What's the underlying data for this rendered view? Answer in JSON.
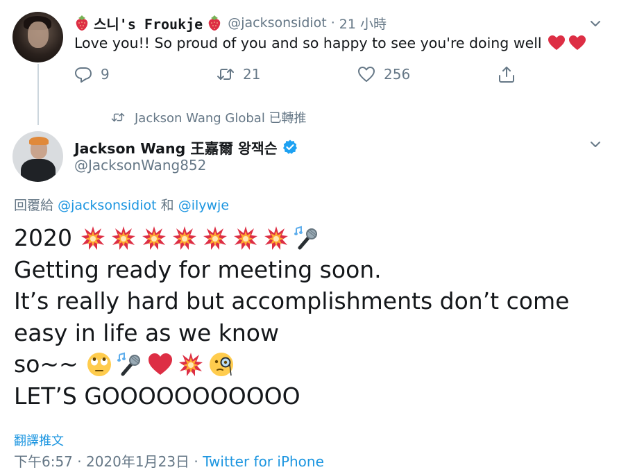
{
  "tweet1": {
    "display_name": "스니's Froukje",
    "handle": "@jacksonsidiot",
    "separator": "·",
    "time": "21 小時",
    "text": "Love you!! So proud of you and so happy to see you're doing well",
    "actions": {
      "replies": "9",
      "retweets": "21",
      "likes": "256"
    }
  },
  "retweet_banner": {
    "text": "Jackson Wang Global 已轉推"
  },
  "tweet2": {
    "display_name": "Jackson Wang 王嘉爾 왕잭슨",
    "handle": "@JacksonWang852",
    "verified": true,
    "reply_prefix": "回覆給",
    "reply_user_1": "@jacksonsidiot",
    "reply_conjunction": "和",
    "reply_user_2": "@ilywje",
    "lines": {
      "l1": "2020",
      "l2": "Getting ready for meeting soon.",
      "l3": "It’s really hard but accomplishments don’t come",
      "l4": "easy in life as we know",
      "l5": "so~~",
      "l6": "LET’S GOOOOOOOOOOO"
    },
    "translate_label": "翻譯推文",
    "timestamp": "下午6:57 · 2020年1月23日",
    "footer_separator": "·",
    "source": "Twitter for iPhone"
  },
  "icons": {
    "strawberry": "strawberry-emoji",
    "heart": "red-heart-emoji",
    "collision": "collision-emoji",
    "microphone": "microphone-emoji",
    "eye_roll": "eye-roll-emoji",
    "monocle": "monocle-face-emoji",
    "reply": "reply-icon",
    "retweet": "retweet-icon",
    "like": "heart-outline-icon",
    "share": "share-icon",
    "verified": "verified-badge-icon",
    "chevron": "chevron-down-icon"
  },
  "colors": {
    "link": "#1b95e0",
    "secondary_text": "#657786",
    "primary_text": "#14171a",
    "verified": "#1da1f2",
    "thread_line": "#ccd6dd"
  }
}
